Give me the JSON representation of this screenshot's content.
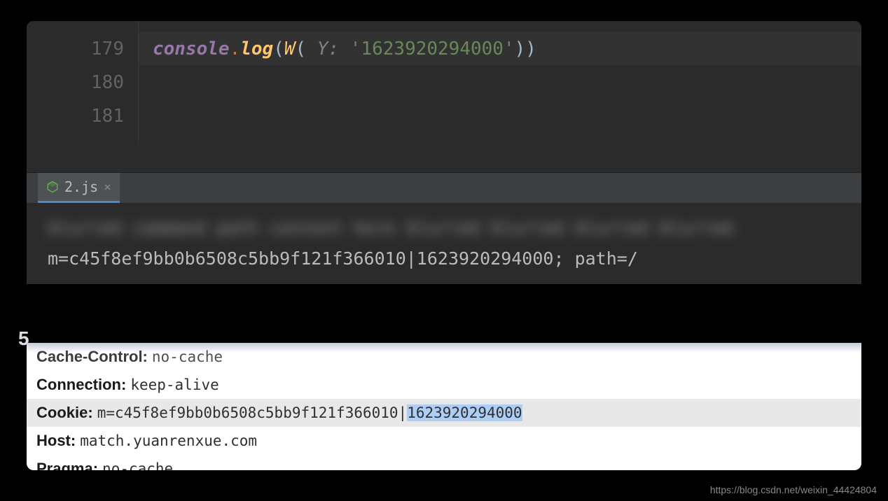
{
  "editor": {
    "lines": [
      {
        "num": "179"
      },
      {
        "num": "180"
      },
      {
        "num": "181"
      }
    ],
    "code_line_179": {
      "obj": "console",
      "dot": ".",
      "method": "log",
      "paren_open": "(",
      "func": "W",
      "inner_open": "(",
      "param_hint": " Y: ",
      "string": "'1623920294000'",
      "inner_close": ")",
      "paren_close": ")"
    }
  },
  "tab": {
    "filename": "2.js"
  },
  "terminal": {
    "blurred_line": "blurred command path content here blurred blurred blurred blurred",
    "output": "m=c45f8ef9bb0b6508c5bb9f121f366010|1623920294000; path=/"
  },
  "headers": {
    "cache_control": {
      "name": "Cache-Control:",
      "value": "no-cache"
    },
    "connection": {
      "name": "Connection:",
      "value": "keep-alive"
    },
    "cookie": {
      "name": "Cookie:",
      "value_prefix": "m=c45f8ef9bb0b6508c5bb9f121f366010|",
      "value_selected": "1623920294000"
    },
    "host": {
      "name": "Host:",
      "value": "match.yuanrenxue.com"
    },
    "pragma": {
      "name": "Pragma:",
      "value": "no-cache"
    }
  },
  "watermark": "https://blog.csdn.net/weixin_44424804",
  "edge_char": "5"
}
